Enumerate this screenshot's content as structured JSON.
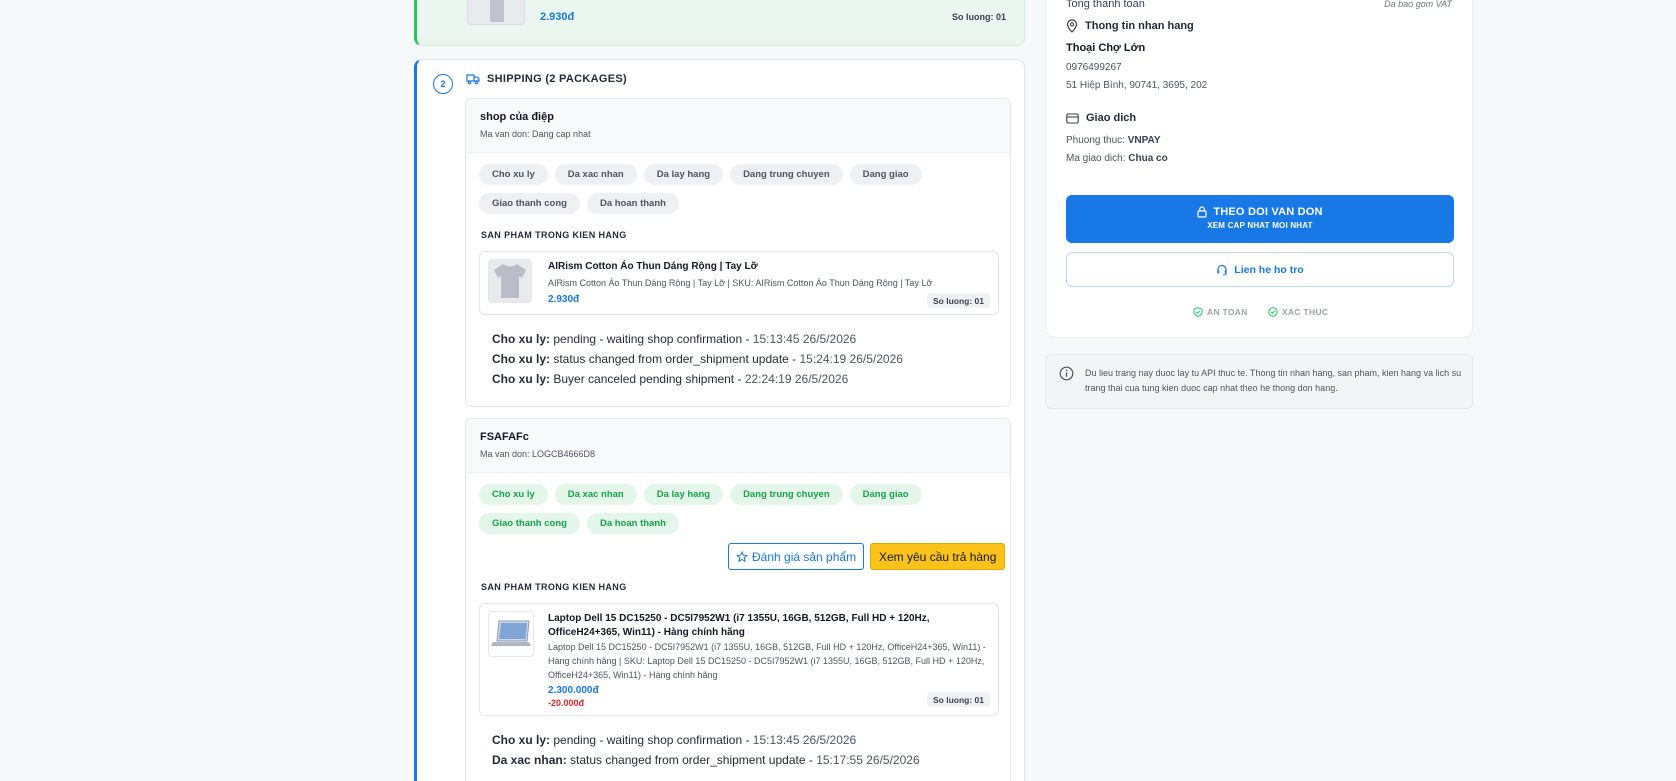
{
  "top_card": {
    "price": "2.930đ",
    "qty": "So luong: 01"
  },
  "shipping": {
    "step": "2",
    "title": "SHIPPING (2 PACKAGES)",
    "packages": [
      {
        "name": "shop của điệp",
        "code": "Ma van don: Dang cap nhat",
        "chips": [
          {
            "label": "Cho xu ly",
            "done": true
          },
          {
            "label": "Da xac nhan",
            "done": false
          },
          {
            "label": "Da lay hang",
            "done": false
          },
          {
            "label": "Dang trung chuyen",
            "done": false
          },
          {
            "label": "Dang giao",
            "done": false
          },
          {
            "label": "Giao thanh cong",
            "done": false
          },
          {
            "label": "Da hoan thanh",
            "done": false
          }
        ],
        "section_label": "SAN PHAM TRONG KIEN HANG",
        "product": {
          "name": "AIRism Cotton Áo Thun Dáng Rộng | Tay Lỡ",
          "desc": "AIRism Cotton Áo Thun Dáng Rộng | Tay Lỡ | SKU: AIRism Cotton Áo Thun Dáng Rộng | Tay Lỡ",
          "price": "2.930đ",
          "qty": "So luong: 01"
        },
        "history": [
          {
            "status": "Cho xu ly:",
            "text": " pending - waiting shop confirmation - ",
            "time": "15:13:45 26/5/2026"
          },
          {
            "status": "Cho xu ly:",
            "text": " status changed from order_shipment update - ",
            "time": "15:24:19 26/5/2026"
          },
          {
            "status": "Cho xu ly:",
            "text": " Buyer canceled pending shipment - ",
            "time": "22:24:19 26/5/2026"
          }
        ]
      },
      {
        "name": "FSAFAFc",
        "code": "Ma van don: LOGCB4666D8",
        "chips": [
          {
            "label": "Cho xu ly",
            "done": true
          },
          {
            "label": "Da xac nhan",
            "done": true
          },
          {
            "label": "Da lay hang",
            "done": true
          },
          {
            "label": "Dang trung chuyen",
            "done": true
          },
          {
            "label": "Dang giao",
            "done": true
          },
          {
            "label": "Giao thanh cong",
            "done": true
          },
          {
            "label": "Da hoan thanh",
            "done": true
          }
        ],
        "review_label": "Đánh giá sản phẩm",
        "return_label": "Xem yêu cầu trả hàng",
        "section_label": "SAN PHAM TRONG KIEN HANG",
        "product": {
          "name": "Laptop Dell 15 DC15250 - DC5I7952W1 (i7 1355U, 16GB, 512GB, Full HD + 120Hz, OfficeH24+365, Win11) - Hàng chính hãng",
          "desc": "Laptop Dell 15 DC15250 - DC5I7952W1 (i7 1355U, 16GB, 512GB, Full HD + 120Hz, OfficeH24+365, Win11) - Hàng chính hãng | SKU: Laptop Dell 15 DC15250 - DC5I7952W1 (i7 1355U, 16GB, 512GB, Full HD + 120Hz, OfficeH24+365, Win11) - Hàng chính hãng",
          "price": "2.300.000đ",
          "discount": "-20.000đ",
          "qty": "So luong: 01"
        },
        "history": [
          {
            "status": "Cho xu ly:",
            "text": " pending - waiting shop confirmation - ",
            "time": "15:13:45 26/5/2026"
          },
          {
            "status": "Da xac nhan:",
            "text": " status changed from order_shipment update - ",
            "time": "15:17:55 26/5/2026"
          }
        ]
      }
    ]
  },
  "sidebar": {
    "total_label": "Tong thanh toan",
    "vat_note": "Da bao gom VAT",
    "receiver_heading": "Thong tin nhan hang",
    "receiver_name": "Thoại Chợ Lớn",
    "receiver_phone": "0976499267",
    "receiver_address": "51 Hiệp Bình, 90741, 3695, 202",
    "transaction_heading": "Giao dich",
    "method_label": "Phuong thuc: ",
    "method_value": "VNPAY",
    "txn_label": "Ma giao dich: ",
    "txn_value": "Chua co",
    "track_title": "THEO DOI VAN DON",
    "track_sub": "XEM CAP NHAT MOI NHAT",
    "support_label": "Lien he ho tro",
    "trust_safe": "AN TOAN",
    "trust_verified": "XAC THUC"
  },
  "note": "Du lieu trang nay duoc lay tu API thuc te. Thong tin nhan hang, san pham, kien hang va lich su trang thai cua tung kien duoc cap nhat theo he thong don hang.",
  "colors": {
    "accent": "#1778e6",
    "success": "#16a34a",
    "warning": "#fbc319",
    "danger": "#dc2626"
  }
}
